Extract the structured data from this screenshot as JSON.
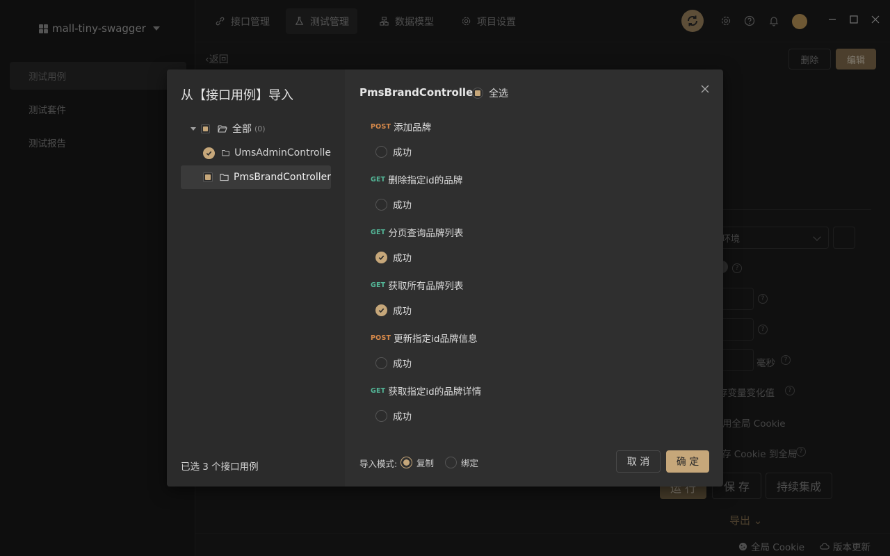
{
  "app": {
    "project_name": "mall-tiny-swagger",
    "sidebar": {
      "items": [
        {
          "label": "测试用例",
          "active": true
        },
        {
          "label": "测试套件"
        },
        {
          "label": "测试报告"
        }
      ]
    },
    "tabs": [
      {
        "label": "接口管理",
        "icon": "link-icon"
      },
      {
        "label": "测试管理",
        "icon": "flask-icon",
        "active": true
      },
      {
        "label": "数据模型",
        "icon": "model-icon"
      },
      {
        "label": "项目设置",
        "icon": "gear-icon"
      }
    ],
    "back_label": "返回",
    "delete_label": "删除",
    "edit_label": "编辑",
    "env_placeholder": "环境",
    "ms_label": "毫秒",
    "save_var_label": "存变量变化值",
    "global_cookie_label": "用全局 Cookie",
    "save_cookie_label": "存 Cookie 到全局",
    "run_label": "运 行",
    "save_label": "保 存",
    "ci_label": "持续集成",
    "export_label": "导出",
    "status_global_cookie": "全局 Cookie",
    "status_update": "版本更新"
  },
  "modal": {
    "title": "从【接口用例】导入",
    "tree": {
      "root": {
        "label": "全部",
        "count": "(0)"
      },
      "controllers": [
        {
          "label": "UmsAdminControlle",
          "state": "checked"
        },
        {
          "label": "PmsBrandController",
          "state": "partial",
          "selected": true
        }
      ]
    },
    "selected_summary": "已选 3 个接口用例",
    "controller_title": "PmsBrandController",
    "select_all_label": "全选",
    "apis": [
      {
        "method": "POST",
        "name": "添加品牌",
        "case": "成功",
        "checked": false
      },
      {
        "method": "GET",
        "name": "删除指定id的品牌",
        "case": "成功",
        "checked": false
      },
      {
        "method": "GET",
        "name": "分页查询品牌列表",
        "case": "成功",
        "checked": true
      },
      {
        "method": "GET",
        "name": "获取所有品牌列表",
        "case": "成功",
        "checked": true
      },
      {
        "method": "POST",
        "name": "更新指定id品牌信息",
        "case": "成功",
        "checked": false
      },
      {
        "method": "GET",
        "name": "获取指定id的品牌详情",
        "case": "成功",
        "checked": false
      }
    ],
    "import_mode_label": "导入模式:",
    "mode_options": [
      {
        "label": "复制",
        "selected": true
      },
      {
        "label": "绑定",
        "selected": false
      }
    ],
    "cancel_label": "取 消",
    "ok_label": "确 定"
  },
  "colors": {
    "accent": "#c6a77a",
    "post": "#d98a4a",
    "get": "#54b899"
  }
}
